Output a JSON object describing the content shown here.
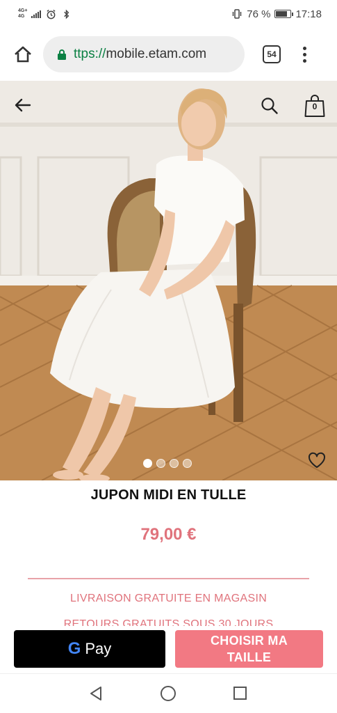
{
  "status_bar": {
    "network_top": "4G+",
    "network_bottom": "4G",
    "battery_percent": "76 %",
    "battery_level": 0.76,
    "time": "17:18",
    "icons": [
      "signal-icon",
      "alarm-icon",
      "bluetooth-icon",
      "vibrate-icon",
      "battery-icon"
    ]
  },
  "browser": {
    "url_scheme": "ttps://",
    "url_host": "mobile.etam.com",
    "tab_count": "54",
    "icons": [
      "home-icon",
      "lock-icon",
      "overflow-menu-icon"
    ]
  },
  "hero": {
    "cart_count": "0",
    "carousel_total": 4,
    "carousel_active": 1,
    "icons": [
      "back-arrow-icon",
      "search-icon",
      "shopping-bag-icon",
      "heart-icon"
    ]
  },
  "product": {
    "title": "JUPON MIDI EN TULLE",
    "price": "79,00 €",
    "shipping_text": "LIVRAISON GRATUITE EN MAGASIN",
    "returns_text": "RETOURS GRATUITS SOUS 30 JOURS"
  },
  "actions": {
    "gpay_g": "G",
    "gpay_label": "Pay",
    "size_button_line1": "CHOISIR MA",
    "size_button_line2": "TAILLE"
  },
  "colors": {
    "accent_pink": "#e0737c",
    "button_pink": "#f27983",
    "url_green": "#0b8043"
  },
  "system_nav": {
    "icons": [
      "nav-back-icon",
      "nav-home-icon",
      "nav-recents-icon"
    ]
  }
}
